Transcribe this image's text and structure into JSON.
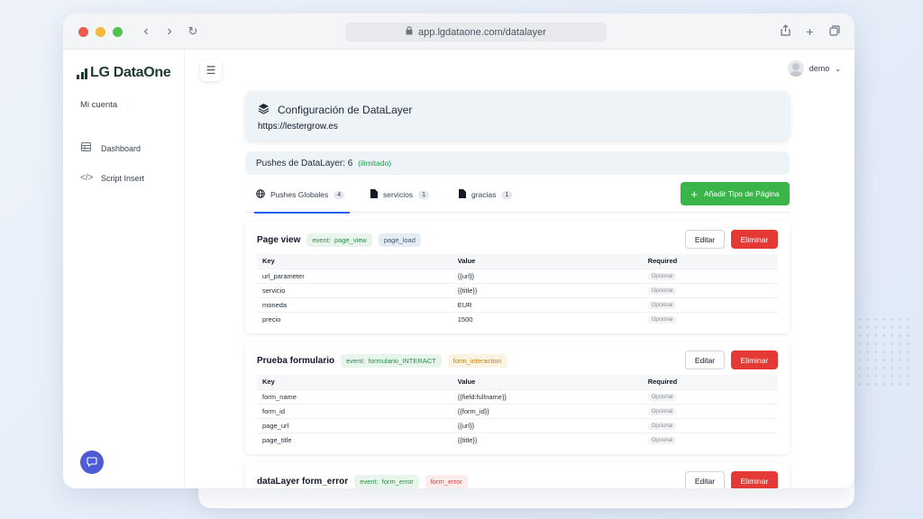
{
  "browser": {
    "url": "app.lgdataone.com/datalayer"
  },
  "sidebar": {
    "logo": "LG DataOne",
    "account": "Mi cuenta",
    "items": [
      {
        "label": "Dashboard",
        "icon": "table-icon"
      },
      {
        "label": "Script Insert",
        "icon": "code-icon"
      }
    ]
  },
  "header": {
    "user": "demo"
  },
  "config": {
    "title": "Configuración de DataLayer",
    "url": "https://lestergrow.es"
  },
  "pushes": {
    "label": "Pushes de DataLayer: 6",
    "limit": "(ilimitado)"
  },
  "tabs": [
    {
      "label": "Pushes Globales",
      "count": "4"
    },
    {
      "label": "servicios",
      "count": "1"
    },
    {
      "label": "gracias",
      "count": "1"
    }
  ],
  "add_button": "Añadir Tipo de Página",
  "columns": {
    "key": "Key",
    "value": "Value",
    "required": "Required"
  },
  "actions": {
    "edit": "Editar",
    "delete": "Eliminar"
  },
  "blocks": [
    {
      "title": "Page view",
      "event_label": "event:",
      "event": "page_view",
      "type": "page_load",
      "rows": [
        [
          "url_parameter",
          "{{url}}",
          "Opcional"
        ],
        [
          "servicio",
          "{{title}}",
          "Opcional"
        ],
        [
          "moneda",
          "EUR",
          "Opcional"
        ],
        [
          "precio",
          "1500",
          "Opcional"
        ]
      ]
    },
    {
      "title": "Prueba formulario",
      "event_label": "event:",
      "event": "formulario_INTERACT",
      "type": "form_interaction",
      "rows": [
        [
          "form_name",
          "{{field:fullname}}",
          "Opcional"
        ],
        [
          "form_id",
          "{{form_id}}",
          "Opcional"
        ],
        [
          "page_url",
          "{{url}}",
          "Opcional"
        ],
        [
          "page_title",
          "{{title}}",
          "Opcional"
        ]
      ]
    },
    {
      "title": "dataLayer form_error",
      "event_label": "event:",
      "event": "form_error",
      "type": "form_error",
      "rows": []
    }
  ],
  "colors": {
    "accent_green": "#3ab54a",
    "danger": "#e53935",
    "tab_active": "#2563eb",
    "logo": "#1e3a2f"
  }
}
